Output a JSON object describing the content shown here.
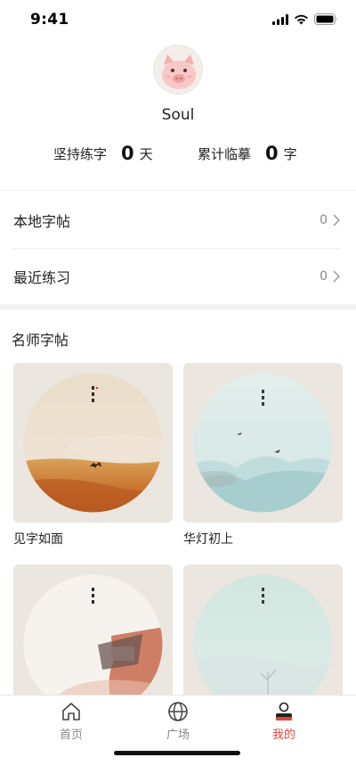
{
  "status_bar": {
    "time": "9:41",
    "icons": [
      "signal-icon",
      "wifi-icon",
      "battery-icon"
    ]
  },
  "profile": {
    "avatar_icon": "pig-avatar-icon",
    "username": "Soul"
  },
  "stats": {
    "streak": {
      "label": "坚持练字",
      "value": "0",
      "unit": "天"
    },
    "total": {
      "label": "累计临摹",
      "value": "0",
      "unit": "字"
    }
  },
  "rows": [
    {
      "label": "本地字帖",
      "count": "0",
      "icon": "chevron-right-icon"
    },
    {
      "label": "最近练习",
      "count": "0",
      "icon": "chevron-right-icon"
    }
  ],
  "section": {
    "title": "名师字帖"
  },
  "cards": [
    {
      "caption": "见字如面",
      "scene": "desert"
    },
    {
      "caption": "华灯初上",
      "scene": "mint-sky"
    },
    {
      "caption": "",
      "scene": "red-ink"
    },
    {
      "caption": "",
      "scene": "mint-mist"
    }
  ],
  "tab_bar": {
    "tabs": [
      {
        "label": "首页",
        "icon": "home-icon",
        "active": false
      },
      {
        "label": "广场",
        "icon": "globe-icon",
        "active": false
      },
      {
        "label": "我的",
        "icon": "profile-icon",
        "active": true
      }
    ],
    "active_color": "#e0463b",
    "inactive_color": "#888888"
  }
}
